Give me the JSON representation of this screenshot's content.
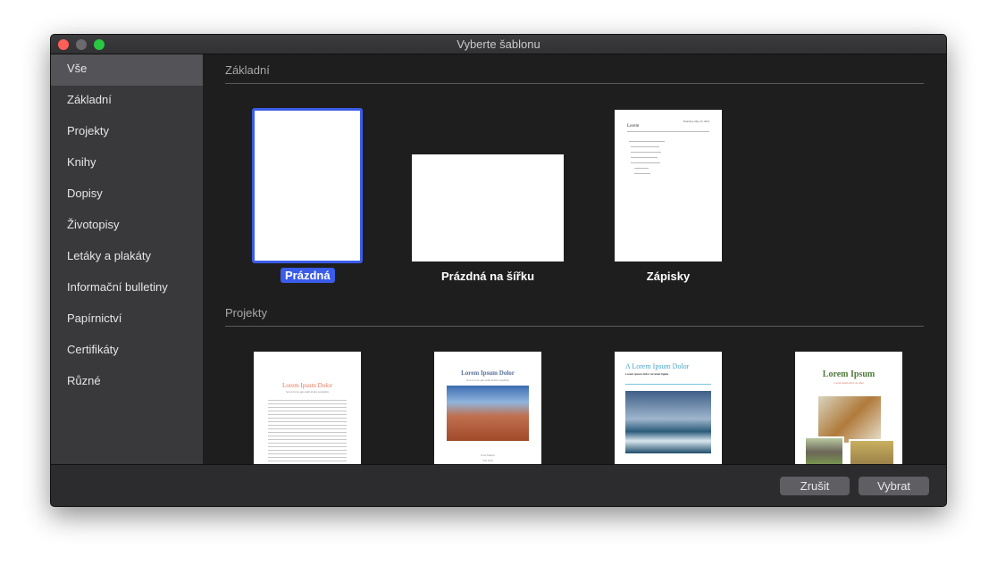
{
  "window": {
    "title": "Vyberte šablonu"
  },
  "sidebar": {
    "items": [
      {
        "label": "Vše"
      },
      {
        "label": "Základní"
      },
      {
        "label": "Projekty"
      },
      {
        "label": "Knihy"
      },
      {
        "label": "Dopisy"
      },
      {
        "label": "Životopisy"
      },
      {
        "label": "Letáky a plakáty"
      },
      {
        "label": "Informační bulletiny"
      },
      {
        "label": "Papírnictví"
      },
      {
        "label": "Certifikáty"
      },
      {
        "label": "Různé"
      }
    ]
  },
  "sections": {
    "basic": {
      "title": "Základní",
      "templates": [
        {
          "label": "Prázdná"
        },
        {
          "label": "Prázdná na šířku"
        },
        {
          "label": "Zápisky",
          "heading": "Lorem",
          "date": "Thursday, May 23, 2019"
        }
      ]
    },
    "projects": {
      "title": "Projekty",
      "templates": [
        {
          "title": "Lorem Ipsum Dolor",
          "subtitle": "Sed ut lacus quis enim mattis nonummy"
        },
        {
          "title": "Lorem Ipsum Dolor",
          "subtitle": "Sed ut lacus quis enim mattis nonummy",
          "author": "Urna Semper",
          "date": "Fall 2019"
        },
        {
          "title": "A Lorem Ipsum Dolor",
          "subtitle": "Lorem ipsum dolor sit amet ligula"
        },
        {
          "title": "Lorem Ipsum",
          "subtitle": "Lorem ipsum dolor sit amet"
        }
      ]
    }
  },
  "footer": {
    "cancel": "Zrušit",
    "choose": "Vybrat"
  },
  "colors": {
    "selection": "#3a5ce8"
  }
}
